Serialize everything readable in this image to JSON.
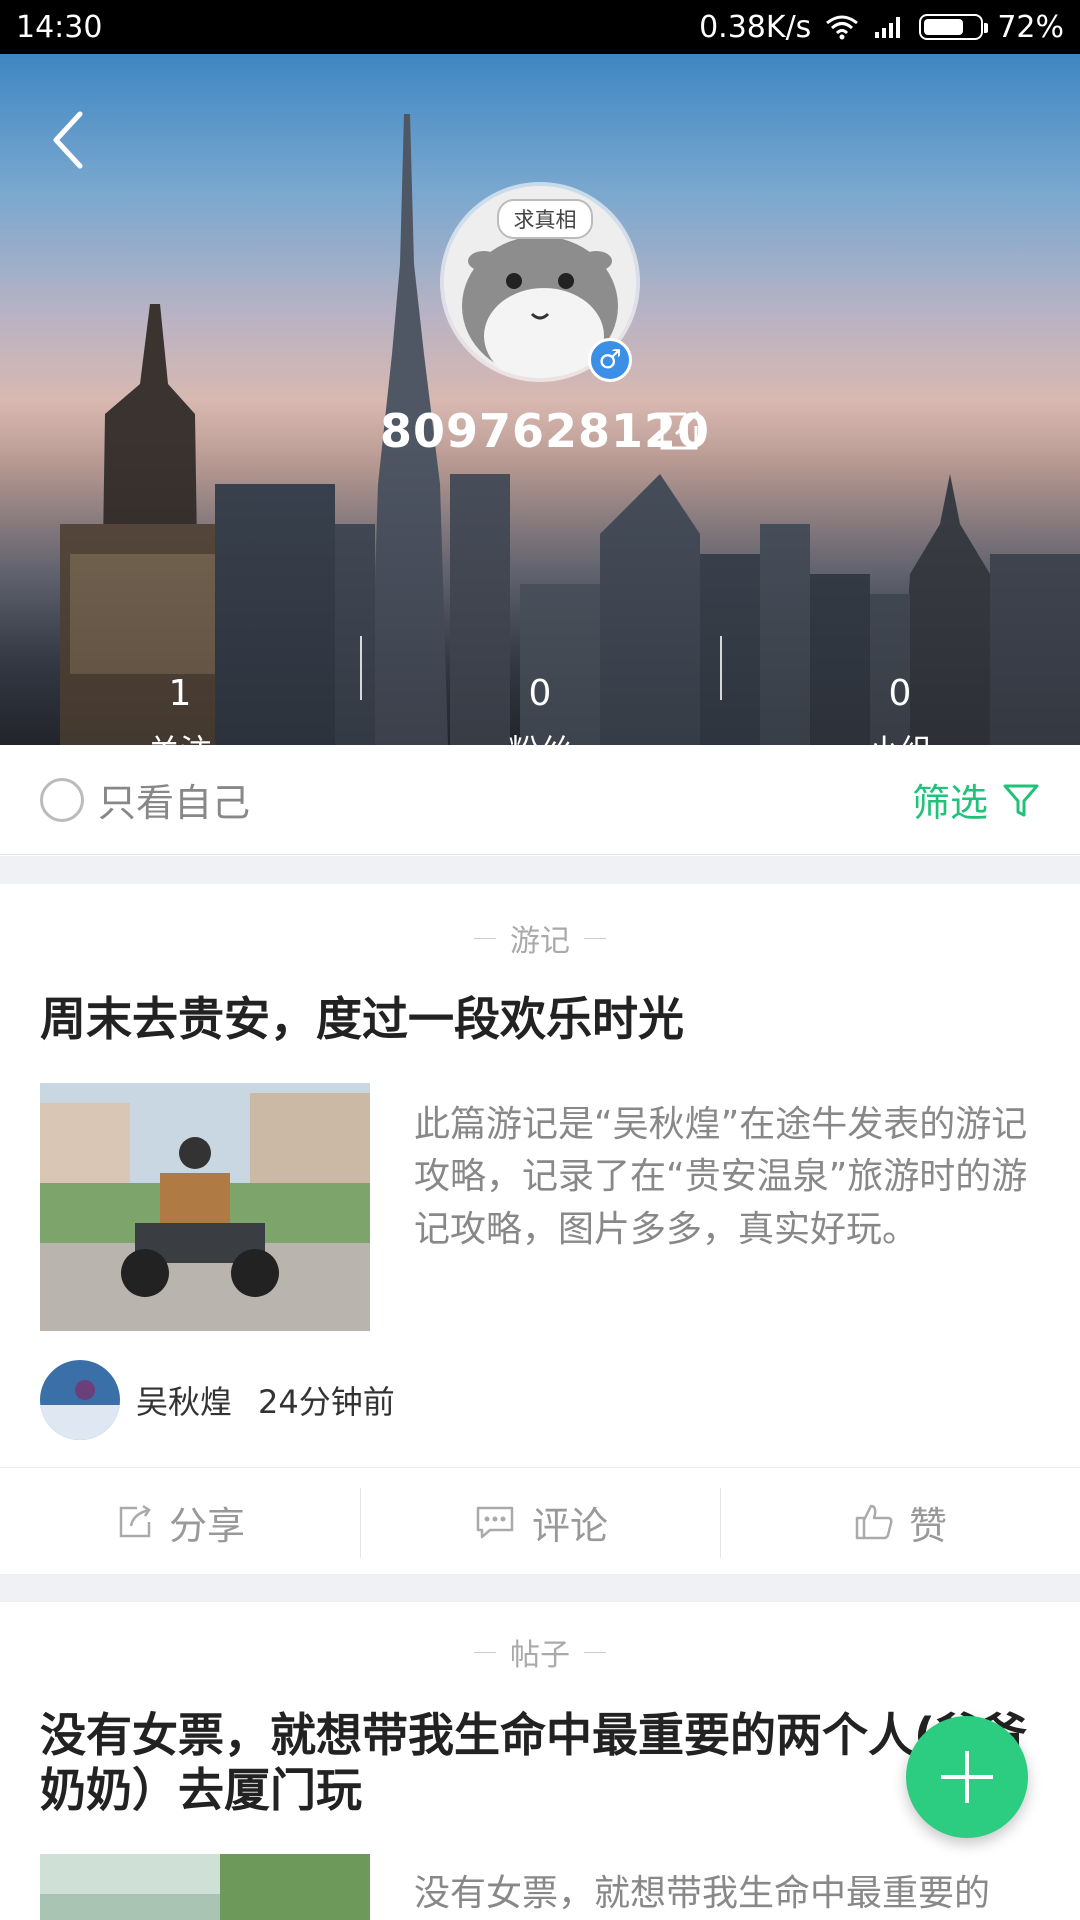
{
  "status_bar": {
    "time": "14:30",
    "net_speed": "0.38K/s",
    "battery_percent": "72%",
    "battery_level": 0.72
  },
  "profile": {
    "username": "8097628120",
    "avatar_text": "求真相",
    "gender_symbol": "♂",
    "stats": [
      {
        "value": "1",
        "label": "关注"
      },
      {
        "value": "0",
        "label": "粉丝"
      },
      {
        "value": "0",
        "label": "小组"
      }
    ]
  },
  "filter": {
    "only_self_label": "只看自己",
    "filter_label": "筛选"
  },
  "feed": [
    {
      "tag": "游记",
      "title": "周末去贵安，度过一段欢乐时光",
      "description": "此篇游记是“吴秋煌”在途牛发表的游记攻略，记录了在“贵安温泉”旅游时的游记攻略，图片多多，真实好玩。",
      "author": "吴秋煌",
      "time": "24分钟前",
      "actions": {
        "share": "分享",
        "comment": "评论",
        "like": "赞"
      }
    },
    {
      "tag": "帖子",
      "title": "没有女票，就想带我生命中最重要的两个人(爷爷奶奶）去厦门玩",
      "description": "没有女票，就想带我生命中最重要的"
    }
  ],
  "colors": {
    "accent_green": "#20c27a",
    "fab_green": "#2ccd80",
    "gender_blue": "#3b8fe5"
  }
}
